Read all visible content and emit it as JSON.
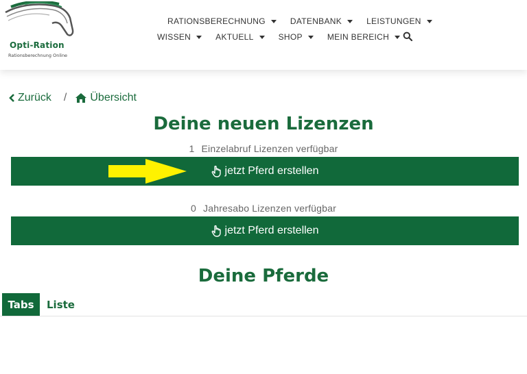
{
  "brand": {
    "name": "Opti-Ration",
    "tagline": "Rationsberechnung Online",
    "color_primary": "#11693a"
  },
  "nav": {
    "row1": [
      {
        "label": "RATIONSBERECHNUNG",
        "icon": "chevron-down-icon"
      },
      {
        "label": "DATENBANK",
        "icon": "chevron-down-icon"
      },
      {
        "label": "LEISTUNGEN",
        "icon": "chevron-down-icon"
      }
    ],
    "row2": [
      {
        "label": "WISSEN",
        "icon": "chevron-down-icon"
      },
      {
        "label": "AKTUELL",
        "icon": "chevron-down-icon"
      },
      {
        "label": "SHOP",
        "icon": "chevron-down-icon"
      },
      {
        "label": "MEIN BEREICH",
        "icon": "chevron-down-icon"
      }
    ],
    "search_icon": "search-icon"
  },
  "breadcrumb": {
    "back_label": "Zurück",
    "separator": "/",
    "overview_label": "Übersicht"
  },
  "licenses": {
    "heading": "Deine neuen Lizenzen",
    "single": {
      "count": "1",
      "label": "Einzelabruf Lizenzen verfügbar",
      "button_label": "jetzt Pferd erstellen"
    },
    "annual": {
      "count": "0",
      "label": "Jahresabo Lizenzen verfügbar",
      "button_label": "jetzt Pferd erstellen"
    }
  },
  "annotation": {
    "arrow_color": "#fff200"
  },
  "horses": {
    "heading": "Deine Pferde",
    "tabs": [
      {
        "label": "Tabs",
        "active": true
      },
      {
        "label": "Liste",
        "active": false
      }
    ]
  }
}
